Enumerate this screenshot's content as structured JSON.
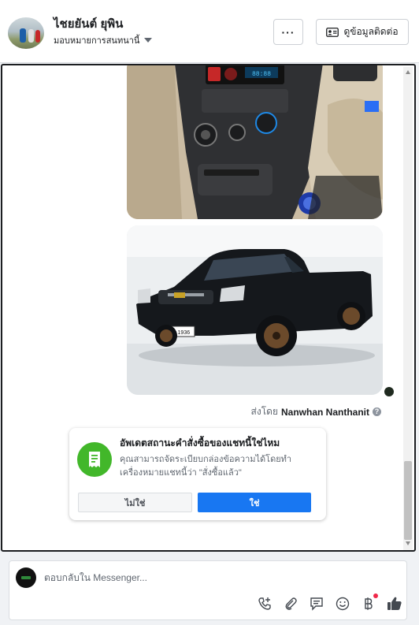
{
  "header": {
    "name": "ไชยยันต์ ยุพิน",
    "assign_label": "มอบหมายการสนทนานี้",
    "more_label": "···",
    "contact_label": "ดูข้อมูลติดต่อ"
  },
  "thread": {
    "sent_by_prefix": "ส่งโดย",
    "sender_name": "Nanwhan Nanthanit",
    "info_glyph": "?"
  },
  "order_card": {
    "title": "อัพเดตสถานะคำสั่งซื้อของแชทนี้ใช่ไหม",
    "description": "คุณสามารถจัดระเบียบกล่องข้อความได้โดยทำเครื่องหมายแชทนี้ว่า \"สั่งซื้อแล้ว\"",
    "no_label": "ไม่ใช่",
    "yes_label": "ใช่"
  },
  "composer": {
    "placeholder": "ตอบกลับใน Messenger..."
  },
  "photos": {
    "plate_text": "ผท 1936"
  },
  "colors": {
    "accent": "#1877f2",
    "success": "#42b72a",
    "car_body": "#15181c",
    "notification": "#f02849"
  },
  "icons": [
    "user-photo-avatar",
    "chevron-down-icon",
    "more-icon",
    "contact-card-icon",
    "info-icon",
    "receipt-icon",
    "phone-add-icon",
    "paperclip-icon",
    "saved-reply-icon",
    "emoji-icon",
    "baht-icon",
    "thumbs-up-icon"
  ]
}
